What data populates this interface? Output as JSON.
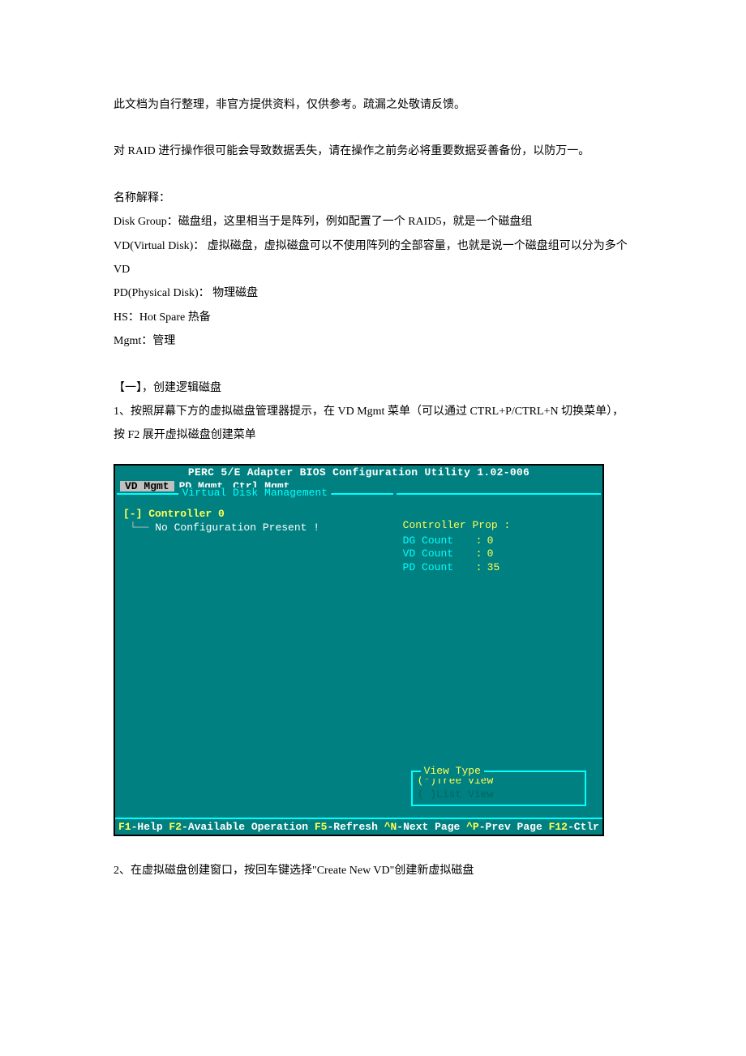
{
  "doc": {
    "p1": "此文档为自行整理，非官方提供资料，仅供参考。疏漏之处敬请反馈。",
    "p2": "对 RAID 进行操作很可能会导致数据丢失，请在操作之前务必将重要数据妥善备份，以防万一。",
    "terms_heading": "名称解释：",
    "terms": {
      "dg": "Disk Group：磁盘组，这里相当于是阵列，例如配置了一个 RAID5，就是一个磁盘组",
      "vd": "VD(Virtual Disk)： 虚拟磁盘，虚拟磁盘可以不使用阵列的全部容量，也就是说一个磁盘组可以分为多个VD",
      "pd": "PD(Physical Disk)： 物理磁盘",
      "hs": "HS：Hot Spare 热备",
      "mgmt": "Mgmt：管理"
    },
    "section1": {
      "heading": "【一】，创建逻辑磁盘",
      "step1": "1、按照屏幕下方的虚拟磁盘管理器提示，在 VD Mgmt 菜单（可以通过 CTRL+P/CTRL+N 切换菜单），按 F2 展开虚拟磁盘创建菜单",
      "step2": "2、在虚拟磁盘创建窗口，按回车键选择\"Create New VD\"创建新虚拟磁盘"
    }
  },
  "bios": {
    "title": "PERC 5/E Adapter BIOS Configuration Utility 1.02-006",
    "tabs": {
      "t1": "VD Mgmt",
      "t2": "PD Mgmt",
      "t3": "Ctrl Mgmt"
    },
    "section_left_label": "Virtual Disk Management",
    "tree": {
      "line1": "[-] Controller 0",
      "line2": "No Configuration Present !"
    },
    "props_title": "Controller Prop :",
    "props": [
      {
        "label": "DG Count",
        "val": "0"
      },
      {
        "label": "VD Count",
        "val": "0"
      },
      {
        "label": "PD Count",
        "val": "35"
      }
    ],
    "viewtype": {
      "title": "View Type",
      "tree": "(*)Tree View",
      "list": "( )List View"
    },
    "footer": {
      "f1": "F1",
      "f1t": "-Help ",
      "f2": "F2",
      "f2t": "-Available Operation ",
      "f5": "F5",
      "f5t": "-Refresh ",
      "n": "^N",
      "nt": "-Next Page ",
      "p": "^P",
      "pt": "-Prev Page ",
      "f12": "F12",
      "f12t": "-Ctlr"
    }
  }
}
